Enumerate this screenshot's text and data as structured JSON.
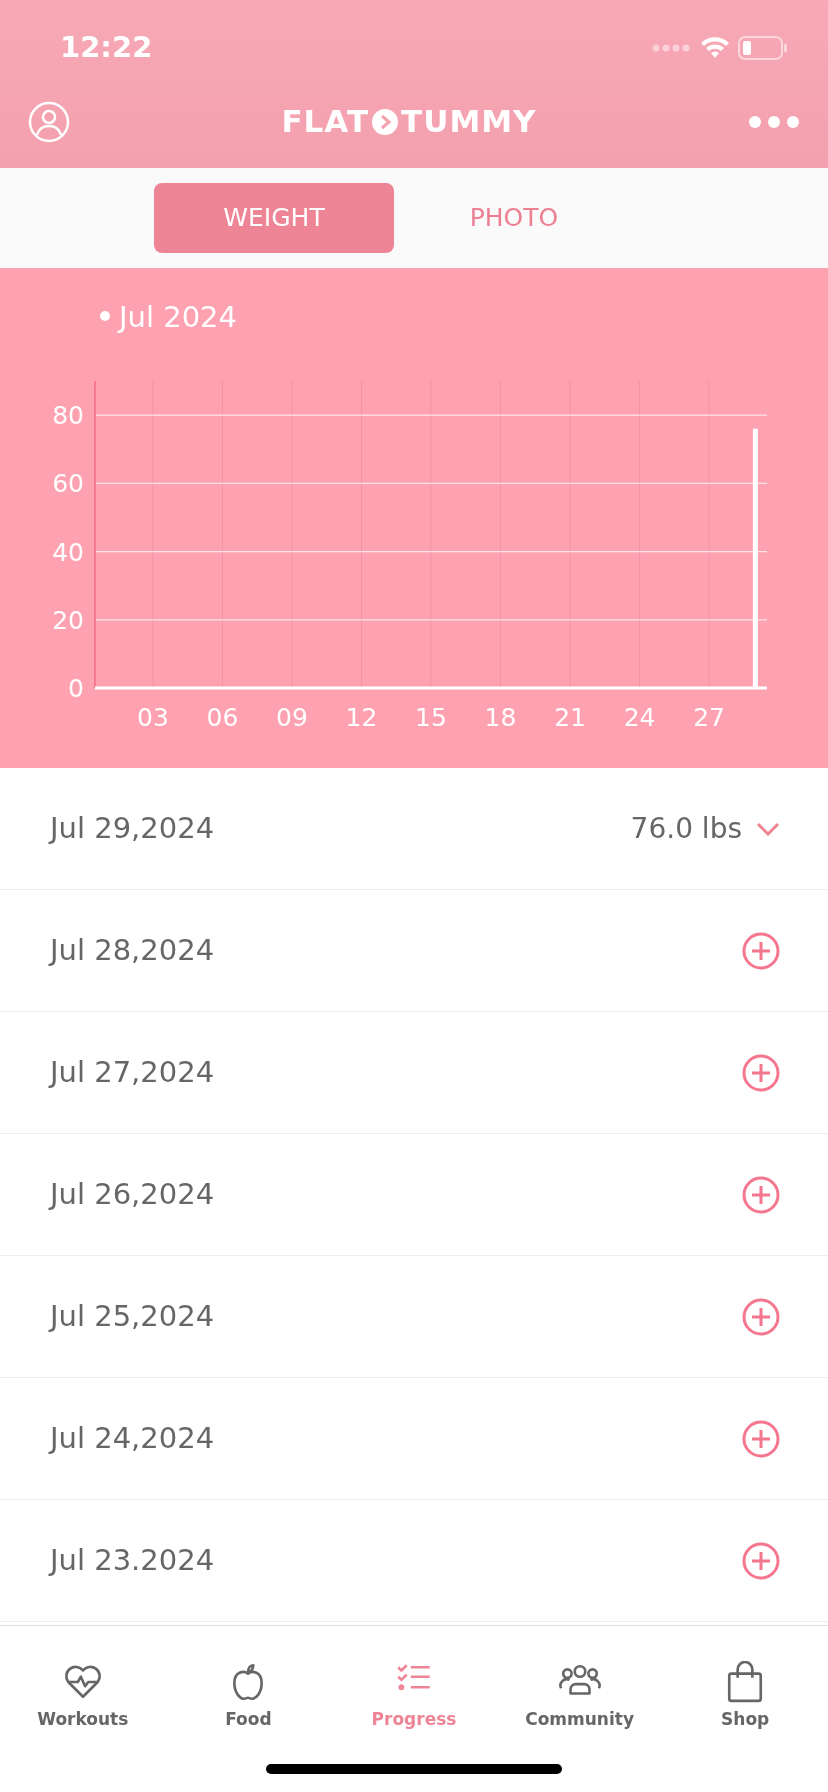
{
  "status_bar": {
    "time": "12:22"
  },
  "header": {
    "logo_left": "FLAT",
    "logo_right": "TUMMY"
  },
  "tabs": [
    {
      "label": "WEIGHT",
      "selected": true
    },
    {
      "label": "PHOTO",
      "selected": false
    }
  ],
  "chart": {
    "legend": "Jul 2024",
    "chart_data": {
      "type": "bar",
      "x": [
        29
      ],
      "values": [
        76
      ],
      "xlim": [
        0.5,
        29.5
      ],
      "ylim": [
        0,
        90
      ],
      "grid": true,
      "xticks": [
        {
          "value": 3,
          "label": "03"
        },
        {
          "value": 6,
          "label": "06"
        },
        {
          "value": 9,
          "label": "09"
        },
        {
          "value": 12,
          "label": "12"
        },
        {
          "value": 15,
          "label": "15"
        },
        {
          "value": 18,
          "label": "18"
        },
        {
          "value": 21,
          "label": "21"
        },
        {
          "value": 24,
          "label": "24"
        },
        {
          "value": 27,
          "label": "27"
        }
      ],
      "yticks": [
        0,
        20,
        40,
        60,
        80
      ]
    }
  },
  "entries": [
    {
      "date": "Jul 29,2024",
      "kind": "logged",
      "value": "76.0 lbs"
    },
    {
      "date": "Jul 28,2024",
      "kind": "empty"
    },
    {
      "date": "Jul 27,2024",
      "kind": "empty"
    },
    {
      "date": "Jul 26,2024",
      "kind": "empty"
    },
    {
      "date": "Jul 25,2024",
      "kind": "empty"
    },
    {
      "date": "Jul 24,2024",
      "kind": "empty"
    },
    {
      "date": "Jul 23.2024",
      "kind": "empty"
    }
  ],
  "nav": [
    {
      "label": "Workouts",
      "kind": "heart",
      "selected": false
    },
    {
      "label": "Food",
      "kind": "apple",
      "selected": false
    },
    {
      "label": "Progress",
      "kind": "checklist",
      "selected": true
    },
    {
      "label": "Community",
      "kind": "people",
      "selected": false
    },
    {
      "label": "Shop",
      "kind": "bag",
      "selected": false
    }
  ]
}
